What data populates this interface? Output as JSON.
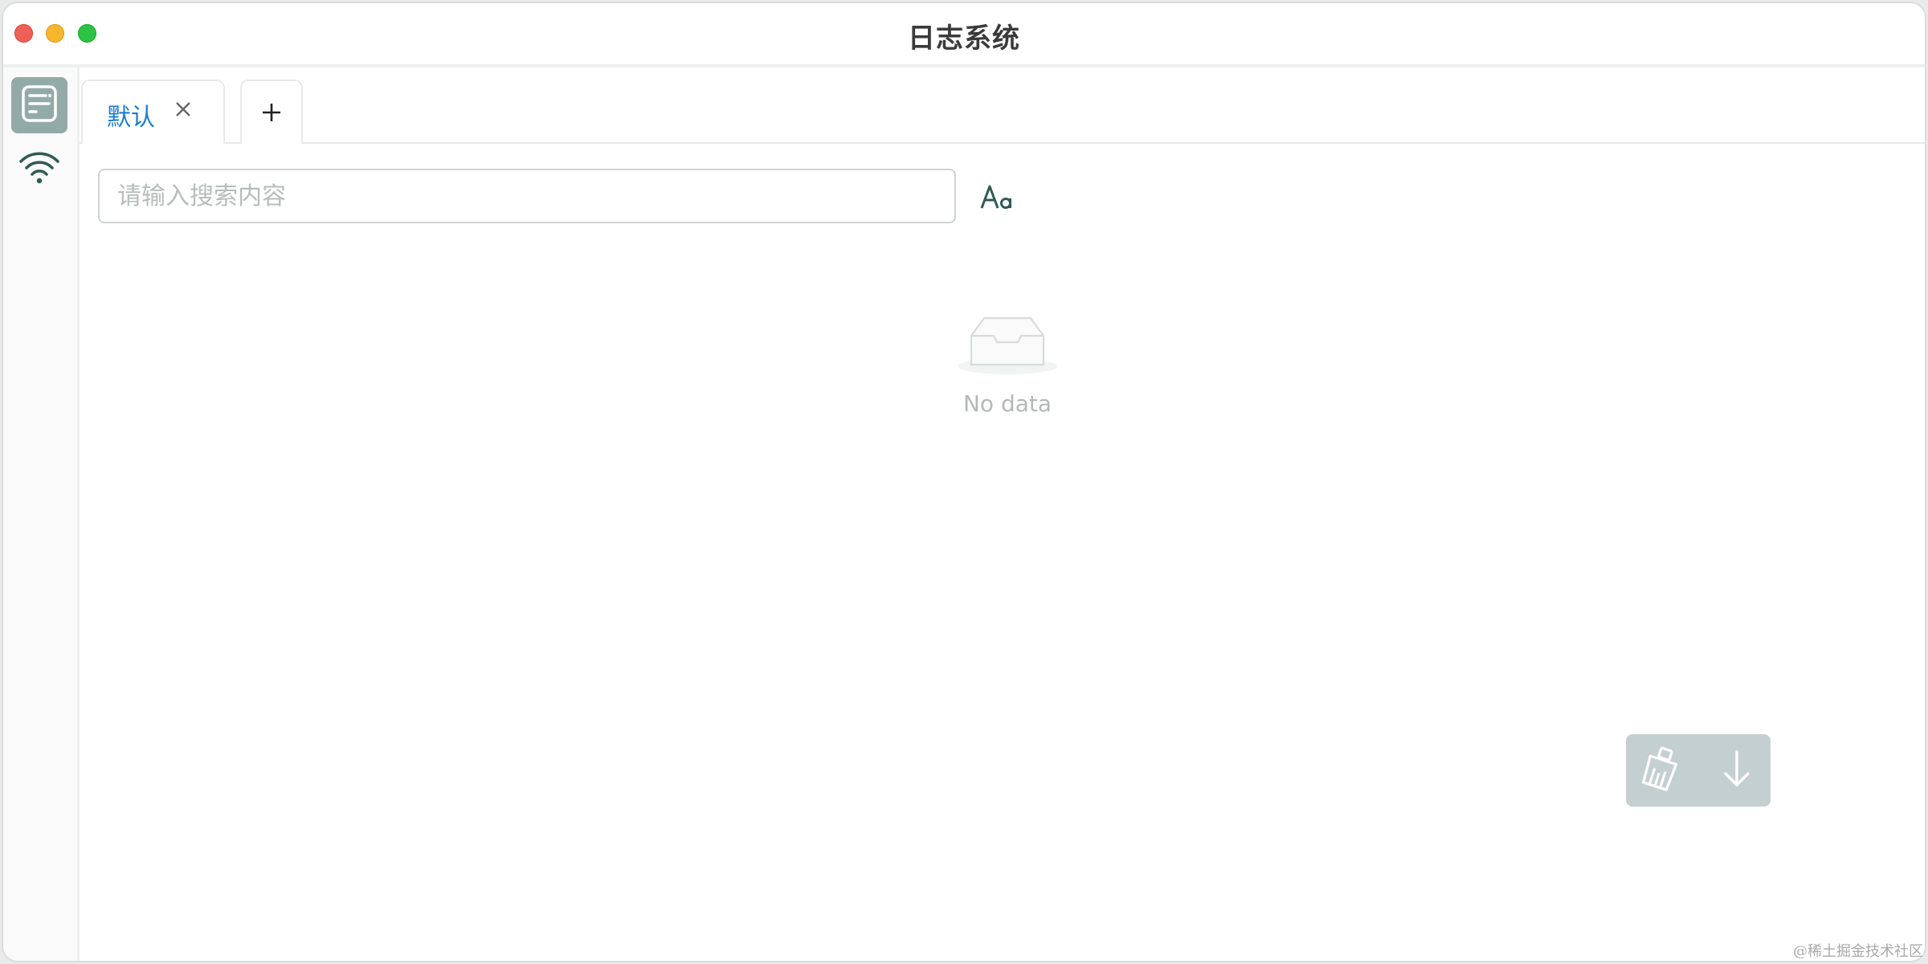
{
  "window": {
    "title": "日志系统"
  },
  "sidebar": {
    "items": [
      {
        "icon": "log-document-icon",
        "active": true
      },
      {
        "icon": "wifi-icon",
        "active": false
      }
    ]
  },
  "tabs": {
    "items": [
      {
        "label": "默认",
        "active": true
      }
    ],
    "add_label": "+"
  },
  "search": {
    "placeholder": "请输入搜索内容",
    "value": "",
    "case_toggle_icon": "match-case-icon"
  },
  "empty_state": {
    "text": "No data",
    "icon": "inbox-icon"
  },
  "floating_actions": {
    "buttons": [
      {
        "icon": "broom-clear-icon"
      },
      {
        "icon": "arrow-down-icon"
      }
    ]
  },
  "watermark": "@稀土掘金技术社区",
  "colors": {
    "accent_tab": "#1a7bd3",
    "sidebar_active": "#93aba7",
    "icon_dark_green": "#2f5a52",
    "fab_background": "#c4d0cf"
  }
}
